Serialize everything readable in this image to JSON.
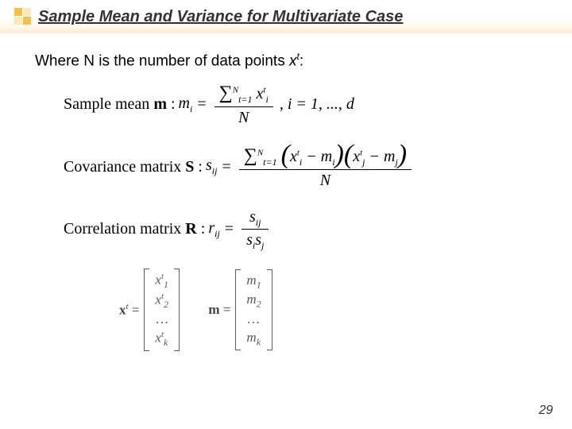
{
  "title": "Sample Mean and Variance for Multivariate Case",
  "intro_prefix": "Where N is the number of data points ",
  "intro_var": "x",
  "intro_sup": "t",
  "intro_suffix": ":",
  "mean": {
    "label_text": "Sample mean ",
    "symbol": "m",
    "lhs_var": "m",
    "lhs_sub": "i",
    "eq": "=",
    "num_sigma": "∑",
    "num_lower": "t=1",
    "num_upper": "N",
    "num_term_var": "x",
    "num_term_sub": "i",
    "num_term_sup": "t",
    "den": "N",
    "tail": ", i = 1, ..., d"
  },
  "cov": {
    "label_text": "Covariance matrix ",
    "symbol": "S",
    "lhs_var": "s",
    "lhs_sub": "ij",
    "eq": "=",
    "num_sigma": "∑",
    "num_lower": "t=1",
    "num_upper": "N",
    "p1_a_var": "x",
    "p1_a_sub": "i",
    "p1_a_sup": "t",
    "p1_minus": " − ",
    "p1_b_var": "m",
    "p1_b_sub": "i",
    "p2_a_var": "x",
    "p2_a_sub": "j",
    "p2_a_sup": "t",
    "p2_minus": " − ",
    "p2_b_var": "m",
    "p2_b_sub": "j",
    "den": "N"
  },
  "corr": {
    "label_text": "Correlation matrix ",
    "symbol": "R",
    "lhs_var": "r",
    "lhs_sub": "ij",
    "eq": "=",
    "num_var": "s",
    "num_sub": "ij",
    "den_a_var": "s",
    "den_a_sub": "i",
    "den_b_var": "s",
    "den_b_sub": "j"
  },
  "vecx": {
    "name_var": "x",
    "name_sup": "t",
    "eq": "=",
    "r1_var": "x",
    "r1_sub": "1",
    "r1_sup": "t",
    "r2_var": "x",
    "r2_sub": "2",
    "r2_sup": "t",
    "r3": "…",
    "r4_var": "x",
    "r4_sub": "k",
    "r4_sup": "t"
  },
  "vecm": {
    "name_var": "m",
    "eq": "=",
    "r1_var": "m",
    "r1_sub": "1",
    "r2_var": "m",
    "r2_sub": "2",
    "r3": "…",
    "r4_var": "m",
    "r4_sub": "k"
  },
  "slide_number": "29"
}
